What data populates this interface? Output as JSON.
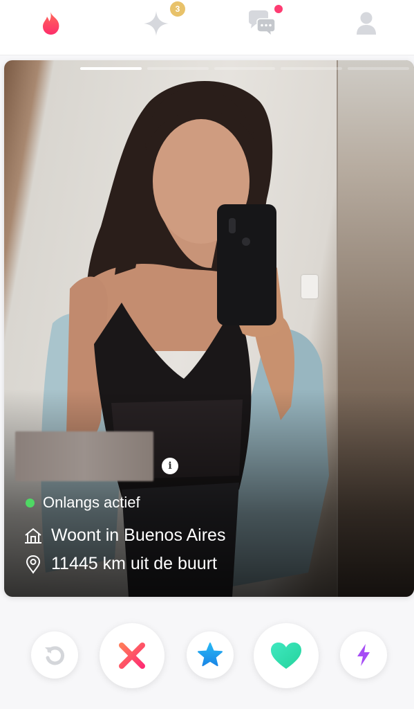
{
  "nav": {
    "flame_icon": "flame-icon",
    "gold_icon": "sparkle-icon",
    "gold_badge": "3",
    "chat_icon": "chat-bubbles-icon",
    "profile_icon": "profile-icon"
  },
  "card": {
    "photo_count": 5,
    "active_photo": 1,
    "status": "Onlangs actief",
    "lives_in": "Woont in Buenos Aires",
    "distance": "11445 km uit de buurt",
    "info_label": "i"
  },
  "actions": {
    "rewind_icon": "rewind-icon",
    "nope_icon": "x-icon",
    "super_like_icon": "star-icon",
    "like_icon": "heart-icon",
    "boost_icon": "lightning-icon"
  },
  "colors": {
    "brand": "#fe3c72",
    "nope": "#fe4a6a",
    "super_like": "#1ea0f0",
    "like": "#2fe3b0",
    "boost": "#a64cf5",
    "online": "#4fd864",
    "gold": "#e8c26a"
  }
}
